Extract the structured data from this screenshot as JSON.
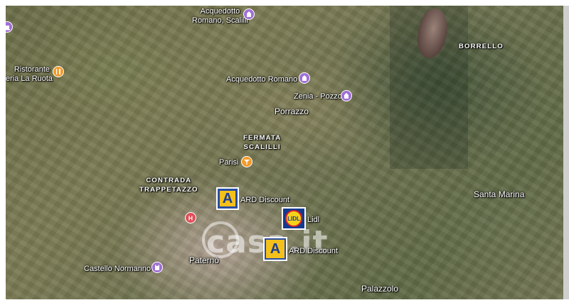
{
  "map": {
    "labels": {
      "acquedotto_scalilli": "Acquedotto\nRomano, Scalilli",
      "acquedotto_romano": "Acquedotto Romano",
      "zenia_pozzo": "Zenia - Pozzo",
      "porrazzo": "Porrazzo",
      "borrello": "BORRELLO",
      "ristorante": "Ristorante\neria La Ruota",
      "fermata": "FERMATA\nSCALILLI",
      "parisi": "Parisi",
      "contrada": "CONTRADA\nTRAPPETAZZO",
      "santa_marina": "Santa Marina",
      "ard1": "ARD Discount",
      "lidl": "Lidl",
      "ard2": "ARD Discount",
      "castello": "Castello Normanno",
      "paterno": "Paternò",
      "palazzolo": "Palazzolo"
    },
    "watermark": "casa.it",
    "brand_ard": "A",
    "brand_lidl": "LIDL",
    "icons": [
      "monument-icon",
      "restaurant-icon",
      "bar-icon",
      "hospital-icon"
    ]
  },
  "colors": {
    "poi": "#a06fd6",
    "food": "#f29b2c",
    "hospital": "#e0505a",
    "ard_blue": "#2a4da0",
    "ard_yellow": "#f4c01a",
    "lidl_blue": "#123a8f",
    "lidl_yellow": "#f4d21a"
  }
}
